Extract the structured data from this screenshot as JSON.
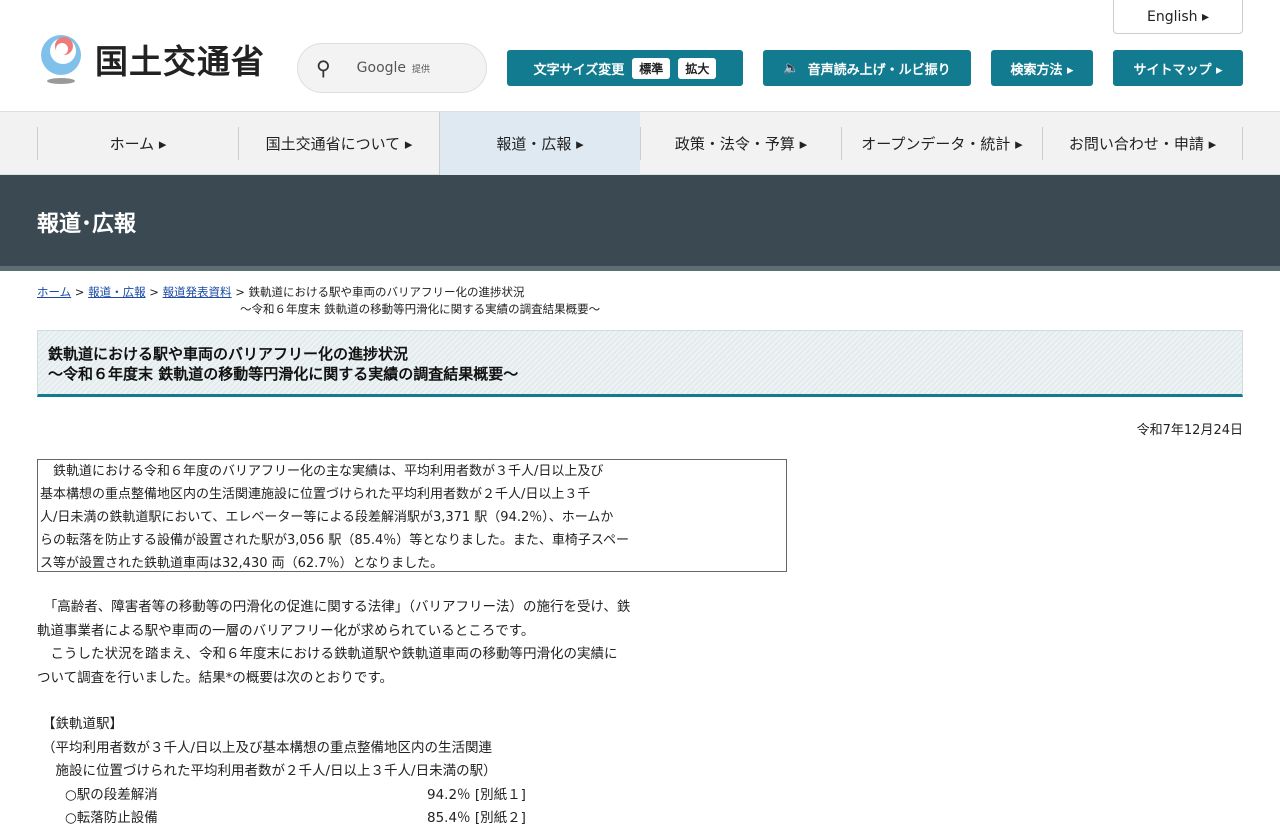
{
  "header": {
    "logo_text": "国土交通省",
    "search_label": "Google",
    "search_provided": "提供",
    "english": "English ▸",
    "font_size_label": "文字サイズ変更",
    "font_standard": "標準",
    "font_large": "拡大",
    "speech_label": "音声読み上げ・ルビ振り",
    "search_method": "検索方法 ▸",
    "sitemap": "サイトマップ ▸"
  },
  "nav": [
    "ホーム ▸",
    "国土交通省について ▸",
    "報道・広報 ▸",
    "政策・法令・予算 ▸",
    "オープンデータ・統計 ▸",
    "お問い合わせ・申請 ▸"
  ],
  "banner": "報道･広報",
  "breadcrumb": {
    "home": "ホーム",
    "press": "報道・広報",
    "releases": "報道発表資料",
    "current1": "鉄軌道における駅や車両のバリアフリー化の進捗状況",
    "current2": "～令和６年度末 鉄軌道の移動等円滑化に関する実績の調査結果概要～"
  },
  "title": {
    "line1": "鉄軌道における駅や車両のバリアフリー化の進捗状況",
    "line2": "～令和６年度末 鉄軌道の移動等円滑化に関する実績の調査結果概要～"
  },
  "date": "令和7年12月24日",
  "summary": [
    "　鉄軌道における令和６年度のバリアフリー化の主な実績は、平均利用者数が３千人/日以上及び",
    "基本構想の重点整備地区内の生活関連施設に位置づけられた平均利用者数が２千人/日以上３千",
    "人/日未満の鉄軌道駅において、エレベーター等による段差解消駅が3,371 駅（94.2％）、ホームか",
    "らの転落を防止する設備が設置された駅が3,056 駅（85.4％）等となりました。また、車椅子スペー",
    "ス等が設置された鉄軌道車両は32,430 両（62.7％）となりました。"
  ],
  "body": [
    "　「高齢者、障害者等の移動等の円滑化の促進に関する法律」（バリアフリー法）の施行を受け、鉄",
    "軌道事業者による駅や車両の一層のバリアフリー化が求められているところです。",
    "　こうした状況を踏まえ、令和６年度末における鉄軌道駅や鉄軌道車両の移動等円滑化の実績に",
    "ついて調査を行いました。結果*の概要は次のとおりです。"
  ],
  "section": {
    "heading": "【鉄軌道駅】",
    "note1": "（平均利用者数が３千人/日以上及び基本構想の重点整備地区内の生活関連",
    "note2": "　施設に位置づけられた平均利用者数が２千人/日以上３千人/日未満の駅）",
    "items": [
      {
        "label": "○駅の段差解消",
        "value": "94.2％ [別紙１]"
      },
      {
        "label": "○転落防止設備",
        "value": "85.4％ [別紙２]"
      }
    ]
  }
}
